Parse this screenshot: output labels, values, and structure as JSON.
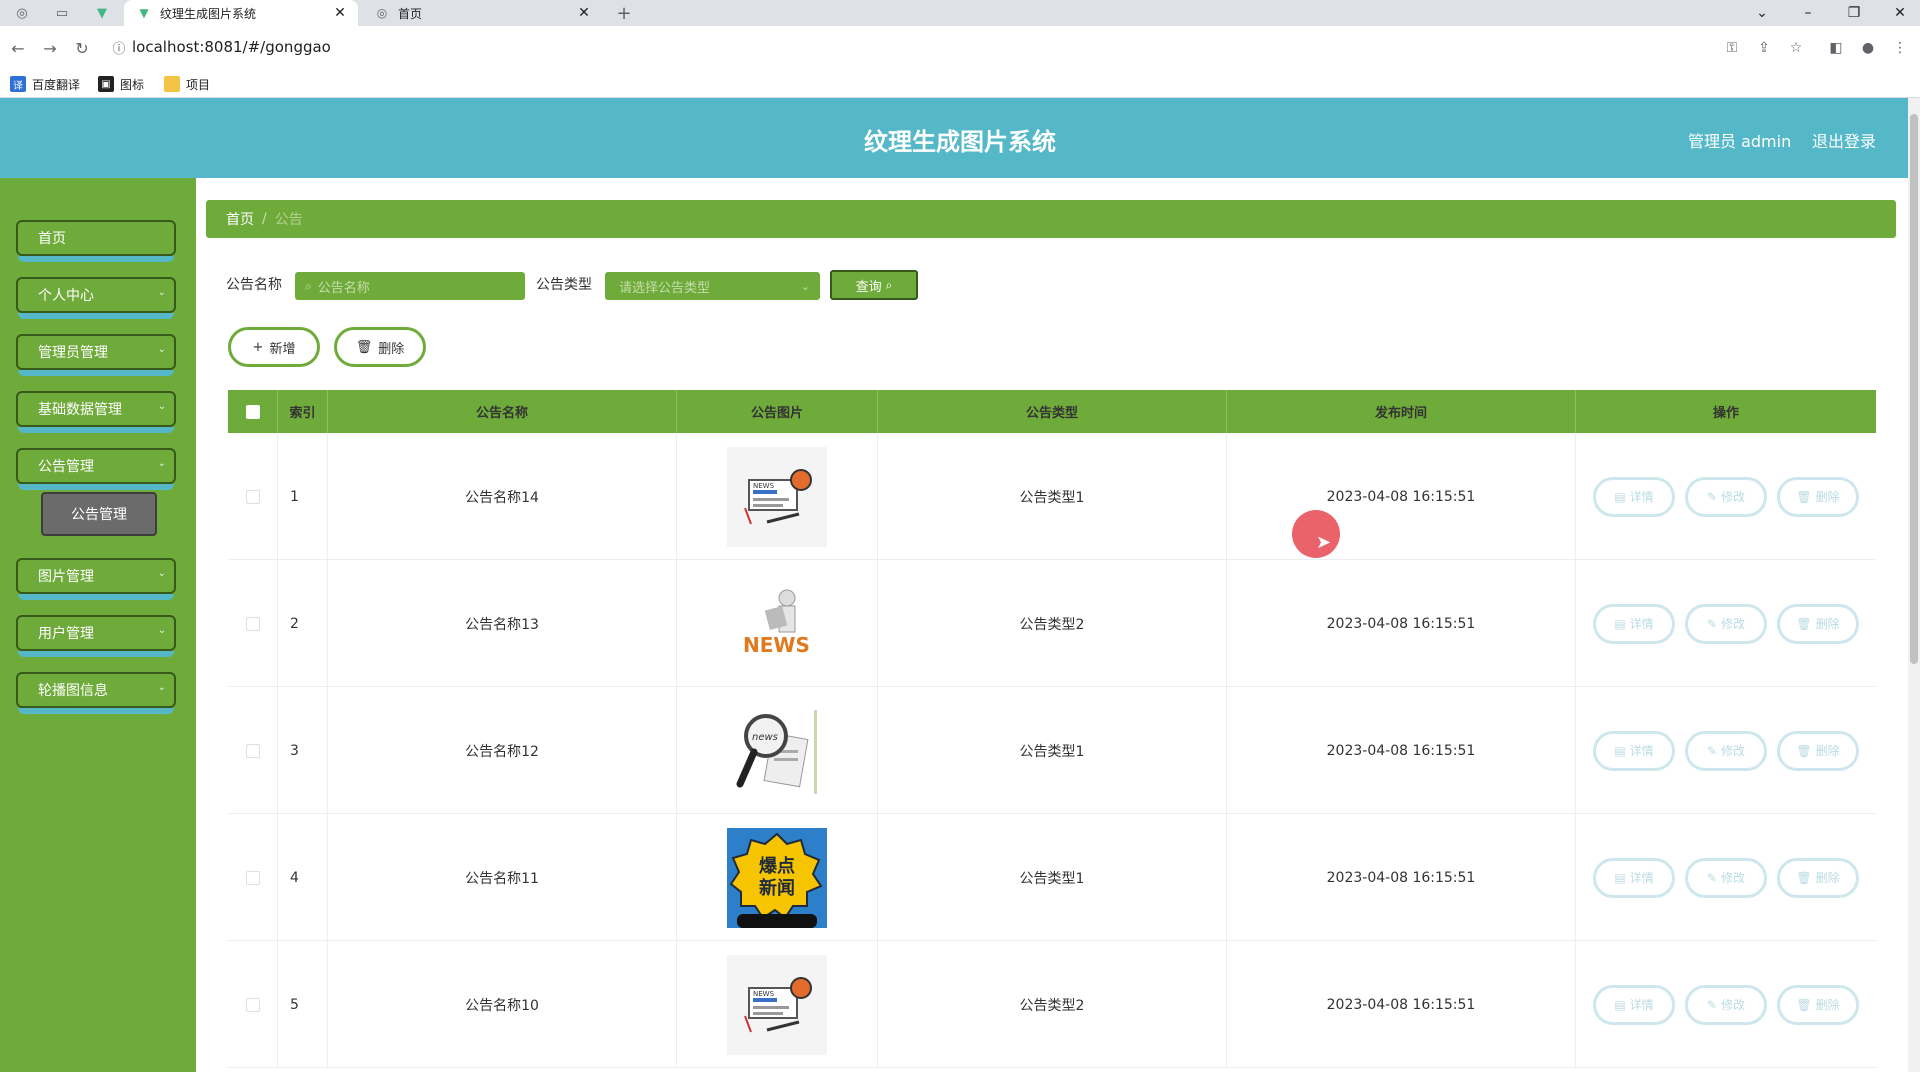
{
  "browser": {
    "tabs": [
      {
        "title": "纹理生成图片系统",
        "active": true
      },
      {
        "title": "首页",
        "active": false
      }
    ],
    "url": "localhost:8081/#/gonggao",
    "bookmarks": [
      "百度翻译",
      "图标",
      "项目"
    ]
  },
  "header": {
    "title": "纹理生成图片系统",
    "user": "管理员 admin",
    "logout": "退出登录"
  },
  "sidebar": {
    "items": [
      {
        "label": "首页",
        "expandable": false
      },
      {
        "label": "个人中心",
        "expandable": true
      },
      {
        "label": "管理员管理",
        "expandable": true
      },
      {
        "label": "基础数据管理",
        "expandable": true
      },
      {
        "label": "公告管理",
        "expandable": true
      },
      {
        "label": "图片管理",
        "expandable": true
      },
      {
        "label": "用户管理",
        "expandable": true
      },
      {
        "label": "轮播图信息",
        "expandable": true
      }
    ],
    "submenu_active": "公告管理"
  },
  "breadcrumb": {
    "home": "首页",
    "separator": "/",
    "current": "公告"
  },
  "filters": {
    "name_label": "公告名称",
    "name_placeholder": "公告名称",
    "type_label": "公告类型",
    "type_placeholder": "请选择公告类型",
    "query_button": "查询"
  },
  "actions": {
    "add": "新增",
    "delete": "删除"
  },
  "table": {
    "columns": [
      "索引",
      "公告名称",
      "公告图片",
      "公告类型",
      "发布时间",
      "操作"
    ],
    "row_actions": {
      "detail": "详情",
      "edit": "修改",
      "delete": "删除"
    },
    "rows": [
      {
        "index": "1",
        "name": "公告名称14",
        "image": "news-laptop-icon",
        "type": "公告类型1",
        "time": "2023-04-08 16:15:51"
      },
      {
        "index": "2",
        "name": "公告名称13",
        "image": "news-figure-icon",
        "type": "公告类型2",
        "time": "2023-04-08 16:15:51"
      },
      {
        "index": "3",
        "name": "公告名称12",
        "image": "news-magnifier-icon",
        "type": "公告类型1",
        "time": "2023-04-08 16:15:51"
      },
      {
        "index": "4",
        "name": "公告名称11",
        "image": "breaking-news-badge",
        "type": "公告类型1",
        "time": "2023-04-08 16:15:51"
      },
      {
        "index": "5",
        "name": "公告名称10",
        "image": "news-laptop-icon",
        "type": "公告类型2",
        "time": "2023-04-08 16:15:51"
      }
    ],
    "badge_text": [
      "爆点",
      "新闻"
    ],
    "news_text": "NEWS"
  }
}
